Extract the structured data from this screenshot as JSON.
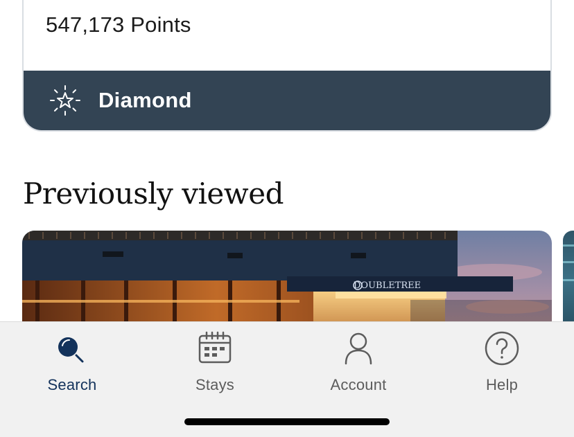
{
  "membership": {
    "points": "547,173 Points",
    "tier": "Diamond",
    "tier_icon": "diamond-star-icon"
  },
  "previously_viewed": {
    "title": "Previously viewed",
    "hotel_sign": "DOUBLETREE"
  },
  "tab_bar": {
    "tabs": [
      {
        "label": "Search",
        "icon": "search-icon",
        "active": true
      },
      {
        "label": "Stays",
        "icon": "calendar-icon",
        "active": false
      },
      {
        "label": "Account",
        "icon": "person-icon",
        "active": false
      },
      {
        "label": "Help",
        "icon": "question-icon",
        "active": false
      }
    ]
  },
  "colors": {
    "tier_bar": "#334454",
    "active_tab": "#13325b",
    "inactive_tab": "#5c5c5c",
    "tab_bar_bg": "#f1f1f1"
  }
}
